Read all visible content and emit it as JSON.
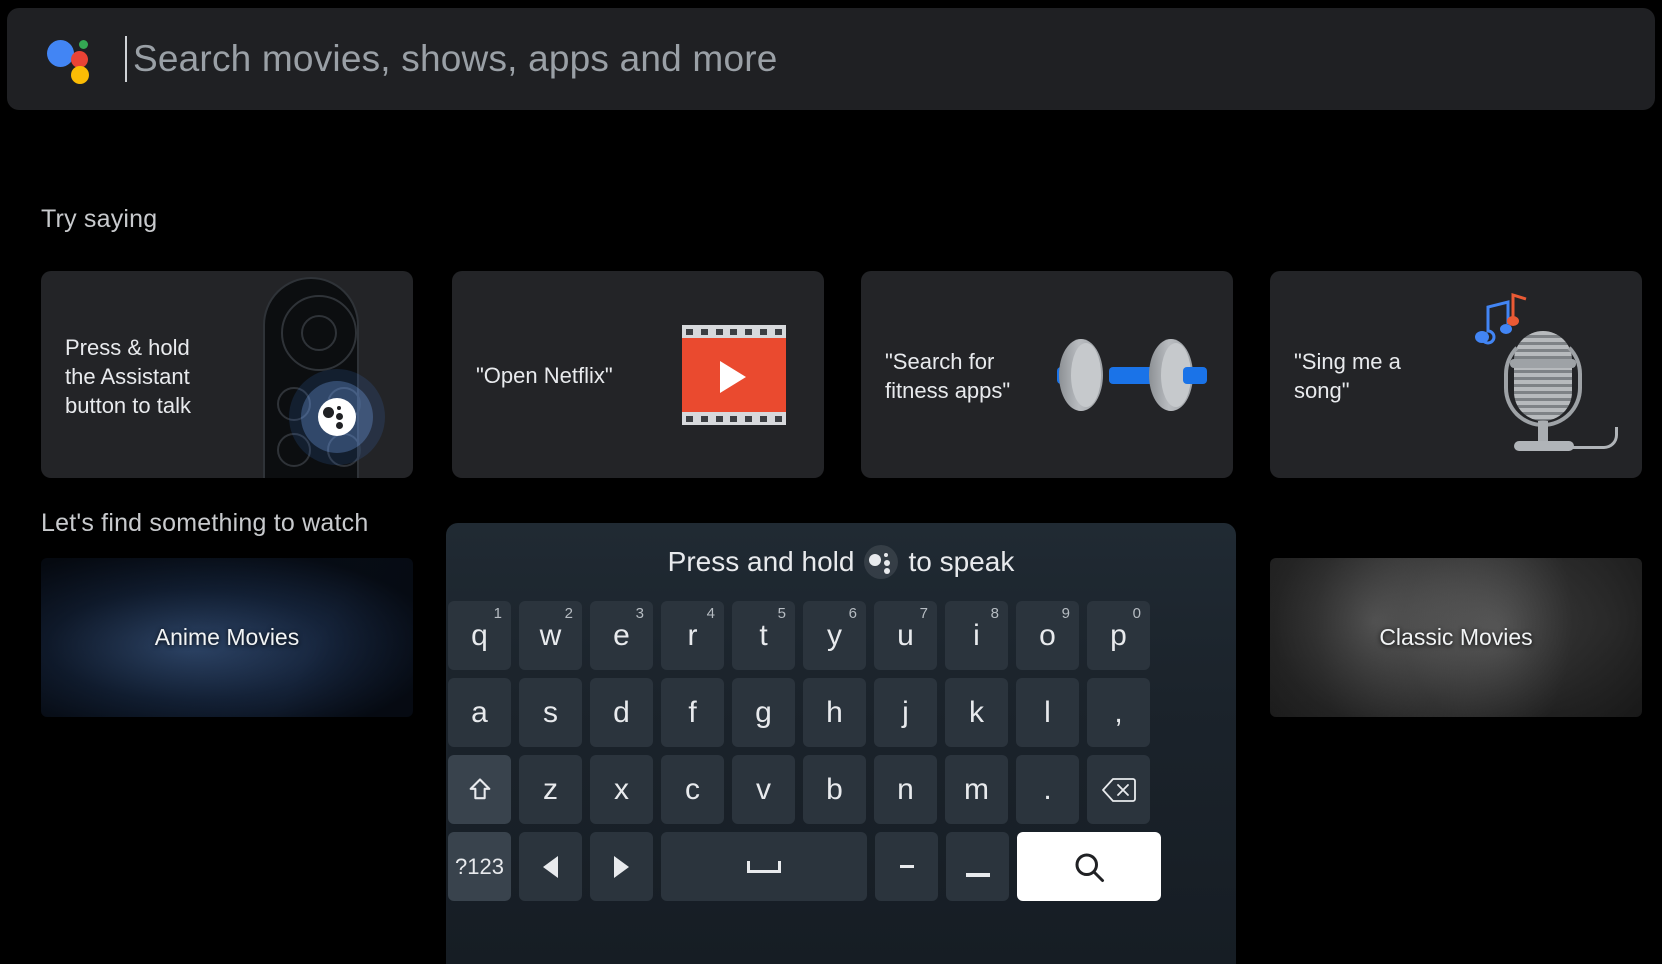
{
  "search": {
    "placeholder": "Search movies, shows, apps and more",
    "assistant_icon": "google-assistant-icon",
    "colors": {
      "blue": "#4285f4",
      "red": "#ea4335",
      "yellow": "#fbbc05",
      "green": "#34a853"
    }
  },
  "try_saying": {
    "title": "Try saying",
    "cards": [
      {
        "label": "Press & hold\nthe Assistant\nbutton to talk",
        "icon": "tv-remote-icon"
      },
      {
        "label": "\"Open Netflix\"",
        "icon": "film-strip-play-icon"
      },
      {
        "label": "\"Search for\nfitness apps\"",
        "icon": "dumbbell-icon"
      },
      {
        "label": "\"Sing me a\nsong\"",
        "icon": "microphone-music-note-icon"
      }
    ]
  },
  "watch": {
    "title": "Let's find something to watch",
    "cards": [
      {
        "label": "Anime Movies"
      },
      {
        "label": "Classic Movies"
      }
    ]
  },
  "keyboard": {
    "hint_before": "Press and hold",
    "hint_after": "to speak",
    "hint_icon": "google-assistant-mono-icon",
    "rows": [
      [
        {
          "label": "q",
          "sup": "1"
        },
        {
          "label": "w",
          "sup": "2"
        },
        {
          "label": "e",
          "sup": "3"
        },
        {
          "label": "r",
          "sup": "4"
        },
        {
          "label": "t",
          "sup": "5"
        },
        {
          "label": "y",
          "sup": "6"
        },
        {
          "label": "u",
          "sup": "7"
        },
        {
          "label": "i",
          "sup": "8"
        },
        {
          "label": "o",
          "sup": "9"
        },
        {
          "label": "p",
          "sup": "0"
        }
      ],
      [
        {
          "label": "a"
        },
        {
          "label": "s"
        },
        {
          "label": "d"
        },
        {
          "label": "f"
        },
        {
          "label": "g"
        },
        {
          "label": "h"
        },
        {
          "label": "j"
        },
        {
          "label": "k"
        },
        {
          "label": "l"
        },
        {
          "label": ","
        }
      ],
      [
        {
          "label": "",
          "icon": "shift-icon"
        },
        {
          "label": "z"
        },
        {
          "label": "x"
        },
        {
          "label": "c"
        },
        {
          "label": "v"
        },
        {
          "label": "b"
        },
        {
          "label": "n"
        },
        {
          "label": "m"
        },
        {
          "label": "."
        },
        {
          "label": "",
          "icon": "backspace-icon"
        }
      ],
      [
        {
          "label": "?123"
        },
        {
          "label": "",
          "icon": "arrow-left-icon"
        },
        {
          "label": "",
          "icon": "arrow-right-icon"
        },
        {
          "label": "",
          "icon": "space-icon"
        },
        {
          "label": "-"
        },
        {
          "label": "_"
        },
        {
          "label": "",
          "icon": "search-icon"
        }
      ]
    ]
  }
}
